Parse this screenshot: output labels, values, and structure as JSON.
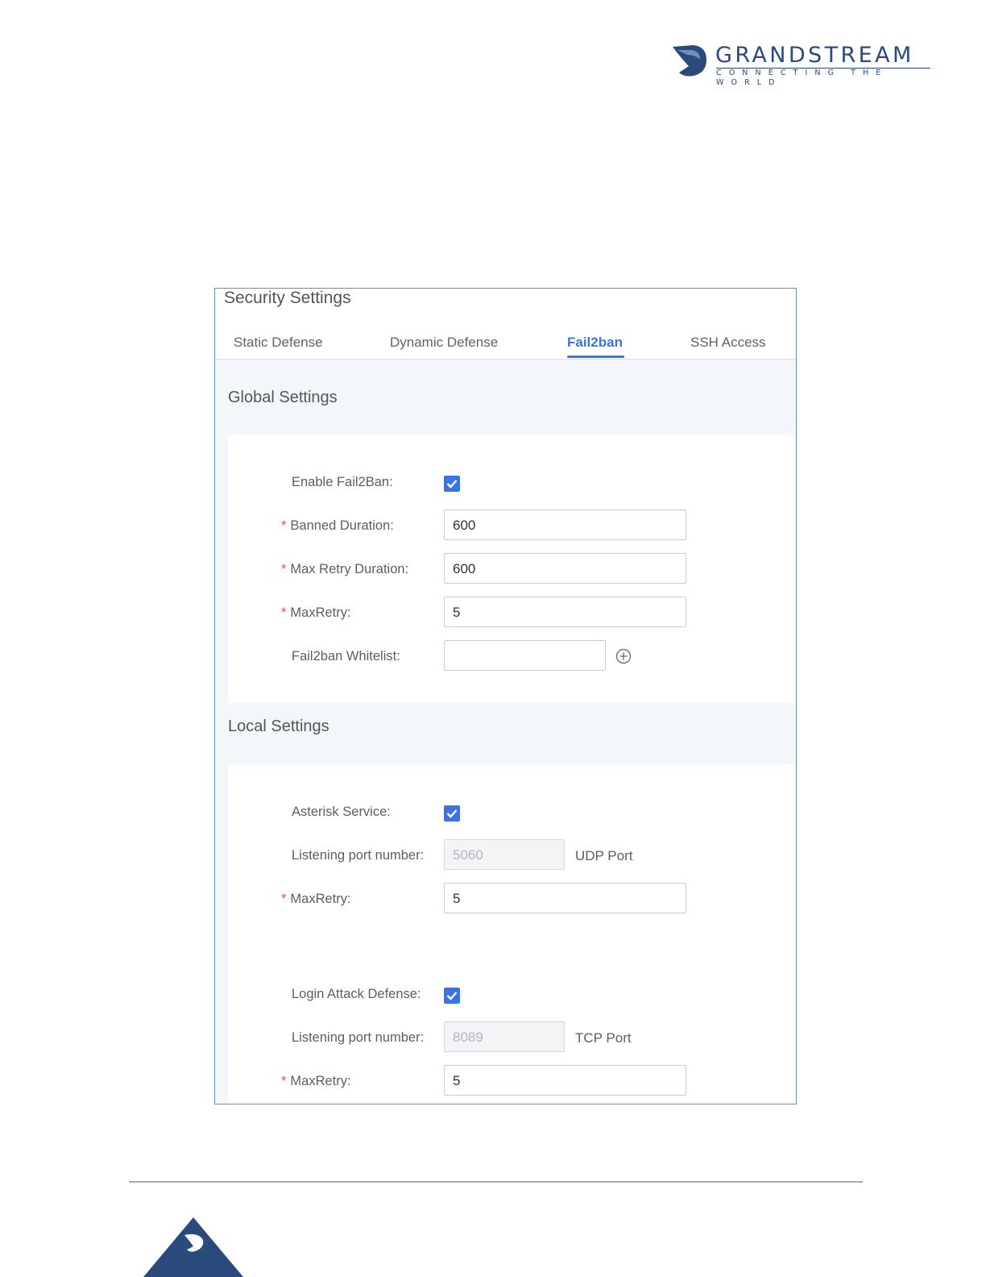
{
  "logo": {
    "wordmark": "GRANDSTREAM",
    "tagline": "CONNECTING THE WORLD",
    "color": "#2b4a7c"
  },
  "panel": {
    "title": "Security Settings",
    "tabs": [
      {
        "label": "Static Defense",
        "active": false
      },
      {
        "label": "Dynamic Defense",
        "active": false
      },
      {
        "label": "Fail2ban",
        "active": true
      },
      {
        "label": "SSH Access",
        "active": false
      }
    ],
    "accent_color": "#3a73e8"
  },
  "global_settings": {
    "title": "Global Settings",
    "enable_fail2ban": {
      "label": "Enable Fail2Ban",
      "checked": true
    },
    "banned_duration": {
      "label": "Banned Duration",
      "value": "600",
      "required": true
    },
    "max_retry_duration": {
      "label": "Max Retry Duration",
      "value": "600",
      "required": true
    },
    "max_retry": {
      "label": "MaxRetry",
      "value": "5",
      "required": true
    },
    "whitelist": {
      "label": "Fail2ban Whitelist",
      "value": "",
      "add_icon": "plus-circle-icon"
    }
  },
  "local_settings": {
    "title": "Local Settings",
    "asterisk_service": {
      "label": "Asterisk Service",
      "checked": true
    },
    "asterisk_port": {
      "label": "Listening port number",
      "value": "5060",
      "suffix": "UDP Port",
      "disabled": true
    },
    "asterisk_max_retry": {
      "label": "MaxRetry",
      "value": "5",
      "required": true
    },
    "login_attack_defense": {
      "label": "Login Attack Defense",
      "checked": true
    },
    "login_port": {
      "label": "Listening port number",
      "value": "8089",
      "suffix": "TCP Port",
      "disabled": true
    },
    "login_max_retry": {
      "label": "MaxRetry",
      "value": "5",
      "required": true
    }
  },
  "colon": ":",
  "required_mark": "*"
}
